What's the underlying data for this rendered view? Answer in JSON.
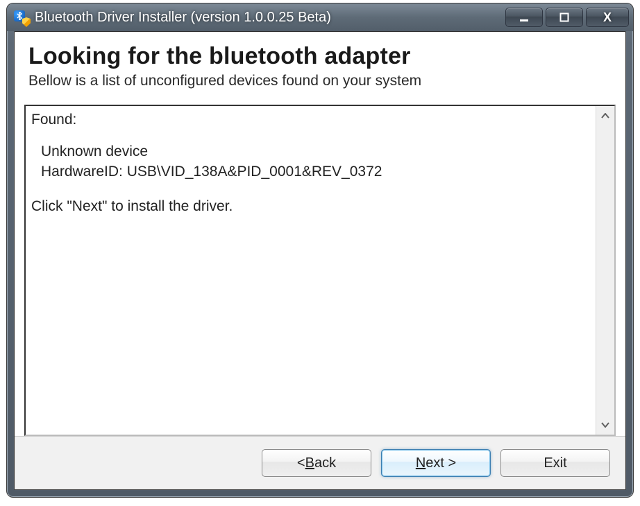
{
  "window": {
    "title": "Bluetooth Driver Installer (version 1.0.0.25 Beta)"
  },
  "header": {
    "heading": "Looking for the bluetooth adapter",
    "subheading": "Bellow is a list of unconfigured devices found on your system"
  },
  "content": {
    "found_label": "Found:",
    "device_name": "Unknown device",
    "hardware_id_label": "HardwareID:",
    "hardware_id_value": "USB\\VID_138A&PID_0001&REV_0372",
    "instruction": "Click \"Next\" to install the driver."
  },
  "buttons": {
    "back_prefix": "< ",
    "back_mnemonic": "B",
    "back_suffix": "ack",
    "next_mnemonic": "N",
    "next_suffix": "ext >",
    "exit": "Exit"
  }
}
